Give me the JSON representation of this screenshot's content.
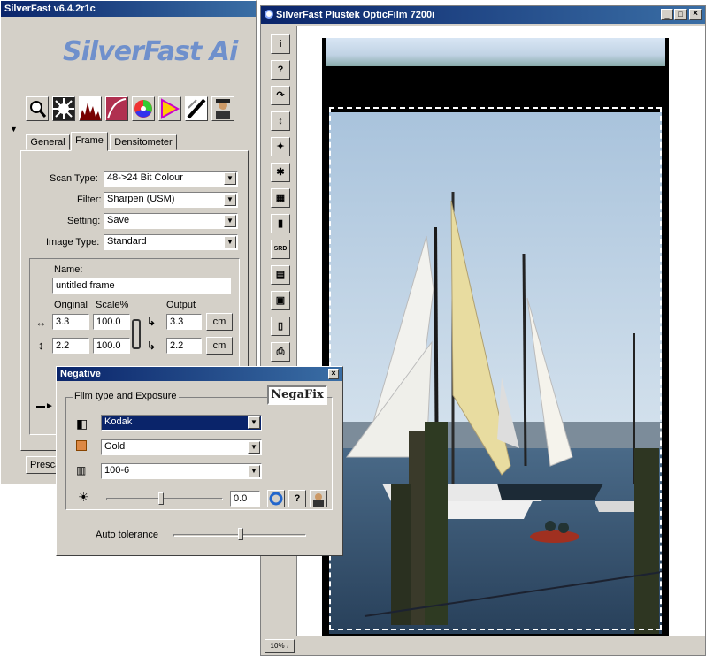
{
  "left_panel": {
    "title": "SilverFast v6.4.2r1c",
    "logo": "SilverFast Ai",
    "toolbar_icons": [
      "magnifier-icon",
      "gradation-icon",
      "histogram-icon",
      "curve-icon",
      "color-wheel-icon",
      "selective-color-icon",
      "sharpen-icon",
      "portrait-icon"
    ],
    "tabs": [
      "General",
      "Frame",
      "Densitometer"
    ],
    "active_tab": "Frame",
    "scan_type_label": "Scan Type:",
    "scan_type_value": "48->24 Bit Colour",
    "filter_label": "Filter:",
    "filter_value": "Sharpen (USM)",
    "setting_label": "Setting:",
    "setting_value": "Save",
    "image_type_label": "Image Type:",
    "image_type_value": "Standard",
    "name_label": "Name:",
    "name_value": "untitled frame",
    "original_label": "Original",
    "scale_label": "Scale%",
    "output_label": "Output",
    "width_original": "3.3",
    "width_scale": "100.0",
    "width_output": "3.3",
    "height_original": "2.2",
    "height_scale": "100.0",
    "height_output": "2.2",
    "unit_label": "cm",
    "prescan_label": "Presca"
  },
  "negative_dialog": {
    "title": "Negative",
    "group_label": "Film type and Exposure",
    "logo": "NegaFix",
    "manufacturer": "Kodak",
    "film": "Gold",
    "speed": "100-6",
    "exposure_value": "0.0",
    "help_label": "?",
    "auto_tolerance_label": "Auto tolerance",
    "exposure_level": 0.45,
    "tolerance_level": 0.5
  },
  "scan_window": {
    "title": "SilverFast Plustek OpticFilm 7200i",
    "zoom": "10%",
    "toolbar": [
      {
        "icon": "info-icon",
        "glyph": "i"
      },
      {
        "icon": "help-icon",
        "glyph": "?"
      },
      {
        "icon": "rotate-icon",
        "glyph": "↷"
      },
      {
        "icon": "flip-icon",
        "glyph": "↕"
      },
      {
        "icon": "mirror-icon",
        "glyph": "✦"
      },
      {
        "icon": "dust-icon",
        "glyph": "✱"
      },
      {
        "icon": "frame-icon",
        "glyph": "▦"
      },
      {
        "icon": "color-icon",
        "glyph": "▮"
      },
      {
        "icon": "srd-icon",
        "glyph": "SRD"
      },
      {
        "icon": "layers-icon",
        "glyph": "▤"
      },
      {
        "icon": "jobmanager-icon",
        "glyph": "▣"
      },
      {
        "icon": "bottle-icon",
        "glyph": "▯"
      },
      {
        "icon": "print-icon",
        "glyph": "⎙"
      },
      {
        "icon": "question-icon",
        "glyph": "?"
      }
    ]
  },
  "colors": {
    "title_bar": "#0a246a",
    "panel": "#d4d0c8",
    "selection": "#0a246a"
  }
}
